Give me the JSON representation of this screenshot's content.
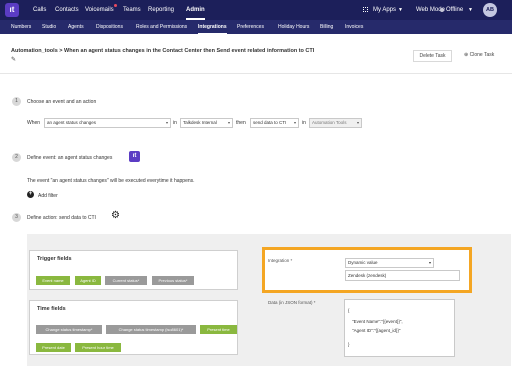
{
  "logo": "ıt",
  "topnav": [
    "Calls",
    "Contacts",
    "Voicemails",
    "Teams",
    "Reporting",
    "Admin"
  ],
  "top_right": {
    "apps": "My Apps",
    "mode": "Web Mode",
    "status": "Offline",
    "avatar": "AB"
  },
  "subnav": [
    "Numbers",
    "Studio",
    "Agents",
    "Dispositions",
    "Roles and Permissions",
    "Integrations",
    "Preferences",
    "Holiday Hours",
    "Billing",
    "Invoices"
  ],
  "page": {
    "title": "Automation_tools > When an agent status changes in the Contact Center then Send event related information to CTI",
    "delete_label": "Delete Task",
    "clone_label": "Clone Task"
  },
  "steps": [
    {
      "num": "1",
      "label": "Choose an event and an action"
    },
    {
      "num": "2",
      "label": "Define event: an agent status changes"
    },
    {
      "num": "3",
      "label": "Define action: send data to CTI"
    }
  ],
  "step1": {
    "when": "When",
    "event_select": "an agent status changes",
    "in1": "in",
    "source_select": "Talkdesk Internal",
    "then": "then",
    "action_select": "send data to CTI",
    "in2": "in",
    "target_select": "Automation Tools"
  },
  "step2": {
    "description": "The event \"an agent status changes\" will be executed everytime it happens.",
    "add_filter": "Add filter"
  },
  "trigger_fields": {
    "title": "Trigger fields",
    "chips": [
      "Event name",
      "Agent ID",
      "Current status*",
      "Previous status*"
    ]
  },
  "time_fields": {
    "title": "Time fields",
    "chips": [
      "Change status timestamp*",
      "Change status timestamp (iso8601)*",
      "Present time",
      "Present date",
      "Present hour time"
    ]
  },
  "integration": {
    "label": "Integration *",
    "select": "Dynamic value",
    "input": "Zendesk (zendesk)"
  },
  "json": {
    "label": "Data (in JSON format) *",
    "lines": [
      "{",
      "\"Event Name\":\"{{event}}\",",
      "\"Agent ID\":\"{{agent_id}}\"",
      "}"
    ]
  },
  "colors": {
    "topbar": "#1c1f5a",
    "subbar": "#262a6b",
    "chip_green": "#8ab83f",
    "chip_grey": "#9a9a9a",
    "highlight": "#f4a623"
  },
  "icons": [
    "grid-icon",
    "chevron-down-icon",
    "status-dot-icon",
    "pencil-icon",
    "clone-icon",
    "talkdesk-icon",
    "plus-icon",
    "gear-icon"
  ]
}
